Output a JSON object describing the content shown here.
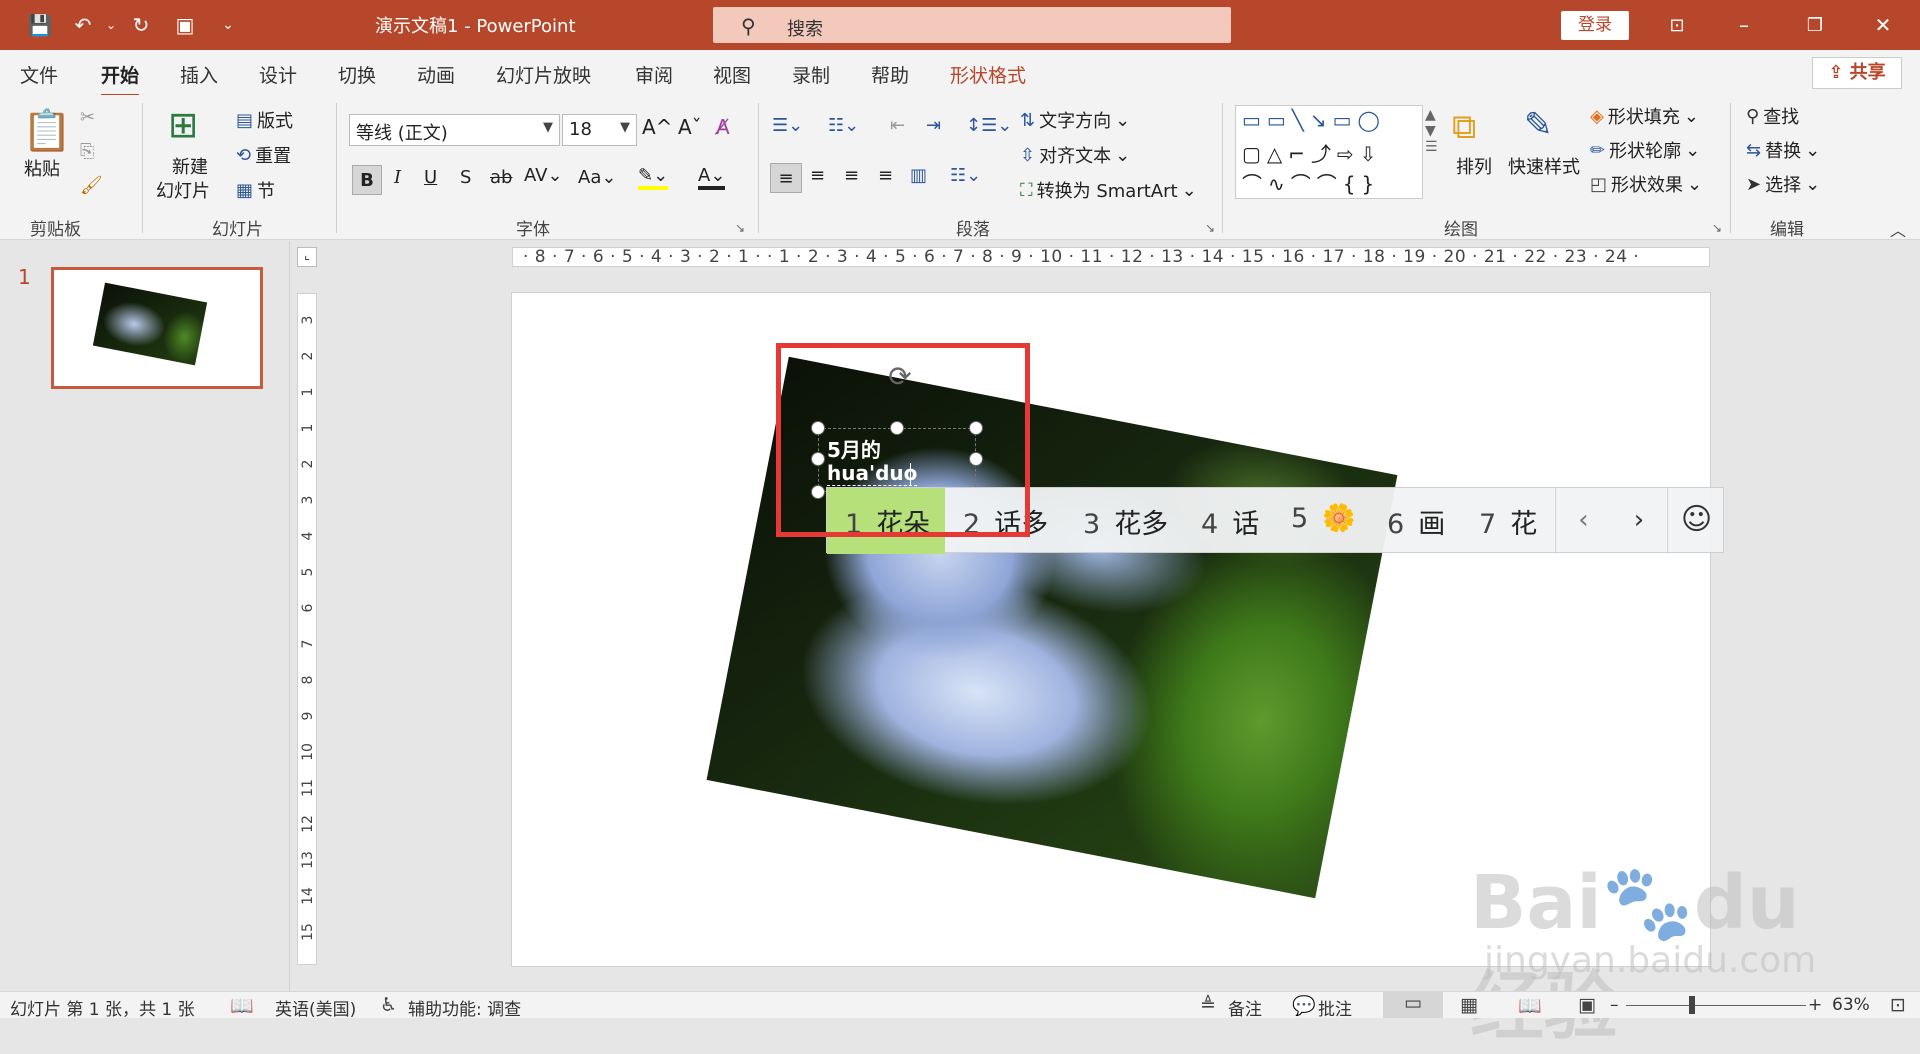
{
  "titlebar": {
    "doc_title": "演示文稿1  -  PowerPoint",
    "search_placeholder": "搜索",
    "login": "登录"
  },
  "tabs": [
    "文件",
    "开始",
    "插入",
    "设计",
    "切换",
    "动画",
    "幻灯片放映",
    "审阅",
    "视图",
    "录制",
    "帮助",
    "形状格式"
  ],
  "active_tab": "开始",
  "share": "共享",
  "ribbon": {
    "clipboard": {
      "paste": "粘贴",
      "label": "剪贴板"
    },
    "slides": {
      "new_slide_l1": "新建",
      "new_slide_l2": "幻灯片",
      "layout": "版式",
      "reset": "重置",
      "section": "节",
      "label": "幻灯片"
    },
    "font": {
      "name": "等线 (正文)",
      "size": "18",
      "label": "字体"
    },
    "paragraph": {
      "text_direction": "文字方向",
      "align_text": "对齐文本",
      "smartart": "转换为 SmartArt",
      "label": "段落"
    },
    "drawing": {
      "arrange": "排列",
      "quick_styles": "快速样式",
      "shape_fill": "形状填充",
      "shape_outline": "形状轮廓",
      "shape_effects": "形状效果",
      "label": "绘图"
    },
    "editing": {
      "find": "查找",
      "replace": "替换",
      "select": "选择",
      "label": "编辑"
    }
  },
  "thumbnail": {
    "number": "1"
  },
  "hruler": "· 8 · 7 · 6 · 5 · 4 · 3 · 2 · 1 ·   · 1 · 2 · 3 · 4 · 5 · 6 · 7 · 8 · 9 · 10 · 11 · 12 · 13 · 14 · 15 · 16 · 17 · 18 · 19 · 20 · 21 · 22 · 23 · 24 ·",
  "vruler": [
    "3",
    "2",
    "1",
    "1",
    "2",
    "3",
    "4",
    "5",
    "6",
    "7",
    "8",
    "9",
    "10",
    "11",
    "12",
    "13",
    "14",
    "15"
  ],
  "textbox": {
    "line1": "5月的",
    "line2": "hua'duo"
  },
  "ime": {
    "candidates": [
      {
        "n": "1",
        "text": "花朵"
      },
      {
        "n": "2",
        "text": "话多"
      },
      {
        "n": "3",
        "text": "花多"
      },
      {
        "n": "4",
        "text": "话"
      },
      {
        "n": "5",
        "text": "🌼"
      },
      {
        "n": "6",
        "text": "画"
      },
      {
        "n": "7",
        "text": "花"
      }
    ],
    "prev": "‹",
    "next": "›",
    "emoji": "☺"
  },
  "watermark": {
    "main": "Bai🐾du 经验",
    "sub": "jingyan.baidu.com"
  },
  "statusbar": {
    "slide_info": "幻灯片 第 1 张，共 1 张",
    "language": "英语(美国)",
    "accessibility": "辅助功能: 调查",
    "notes": "备注",
    "comments": "批注",
    "zoom": "63%"
  },
  "colors": {
    "accent": "#b7472a",
    "ime_highlight": "#b5e07a",
    "annotation_red": "#e53936"
  }
}
